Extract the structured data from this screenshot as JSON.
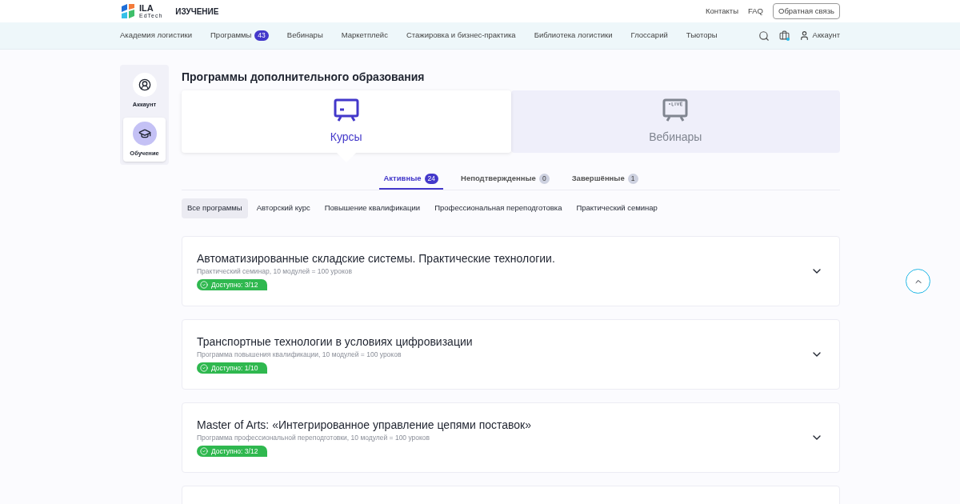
{
  "header": {
    "logo_title": "ILA",
    "logo_subtitle": "EdTech",
    "section": "ИЗУЧЕНИЕ",
    "links": [
      "Контакты",
      "FAQ"
    ],
    "feedback_button": "Обратная связь"
  },
  "nav": {
    "items": [
      {
        "label": "Академия логистики"
      },
      {
        "label": "Программы",
        "badge": "43"
      },
      {
        "label": "Вебинары"
      },
      {
        "label": "Маркетплейс"
      },
      {
        "label": "Стажировка и бизнес-практика"
      },
      {
        "label": "Библиотека логистики"
      },
      {
        "label": "Глоссарий"
      },
      {
        "label": "Тьюторы"
      }
    ],
    "account": "Аккаунт"
  },
  "sidebar": {
    "items": [
      {
        "label": "Аккаунт",
        "kind": "account",
        "selected": false
      },
      {
        "label": "Обучение",
        "kind": "study",
        "selected": true
      }
    ]
  },
  "page_title": "Программы дополнительного образования",
  "type_tabs": [
    {
      "label": "Курсы",
      "kind": "courses",
      "selected": true
    },
    {
      "label": "Вебинары",
      "kind": "webinars",
      "selected": false
    }
  ],
  "status_tabs": [
    {
      "label": "Активные",
      "count": "24",
      "selected": true
    },
    {
      "label": "Неподтвержденные",
      "count": "0",
      "selected": false
    },
    {
      "label": "Завершённые",
      "count": "1",
      "selected": false
    }
  ],
  "filters": [
    {
      "label": "Все программы",
      "selected": true
    },
    {
      "label": "Авторский курс",
      "selected": false
    },
    {
      "label": "Повышение квалификации",
      "selected": false
    },
    {
      "label": "Профессиональная переподготовка",
      "selected": false
    },
    {
      "label": "Практический семинар",
      "selected": false
    }
  ],
  "programs": [
    {
      "title": "Автоматизированные складские системы. Практические технологии.",
      "subtitle": "Практический семинар, 10 модулей = 100 уроков",
      "availability": "Доступно: 3/12"
    },
    {
      "title": "Транспортные технологии в условиях цифровизации",
      "subtitle": "Программа повышения квалификации, 10 модулей = 100 уроков",
      "availability": "Доступно: 1/10"
    },
    {
      "title": "Master of Arts: «Интегрированное управление цепями поставок»",
      "subtitle": "Программа профессиональной переподготовки, 10 модулей = 100 уроков",
      "availability": "Доступно: 3/12"
    }
  ]
}
